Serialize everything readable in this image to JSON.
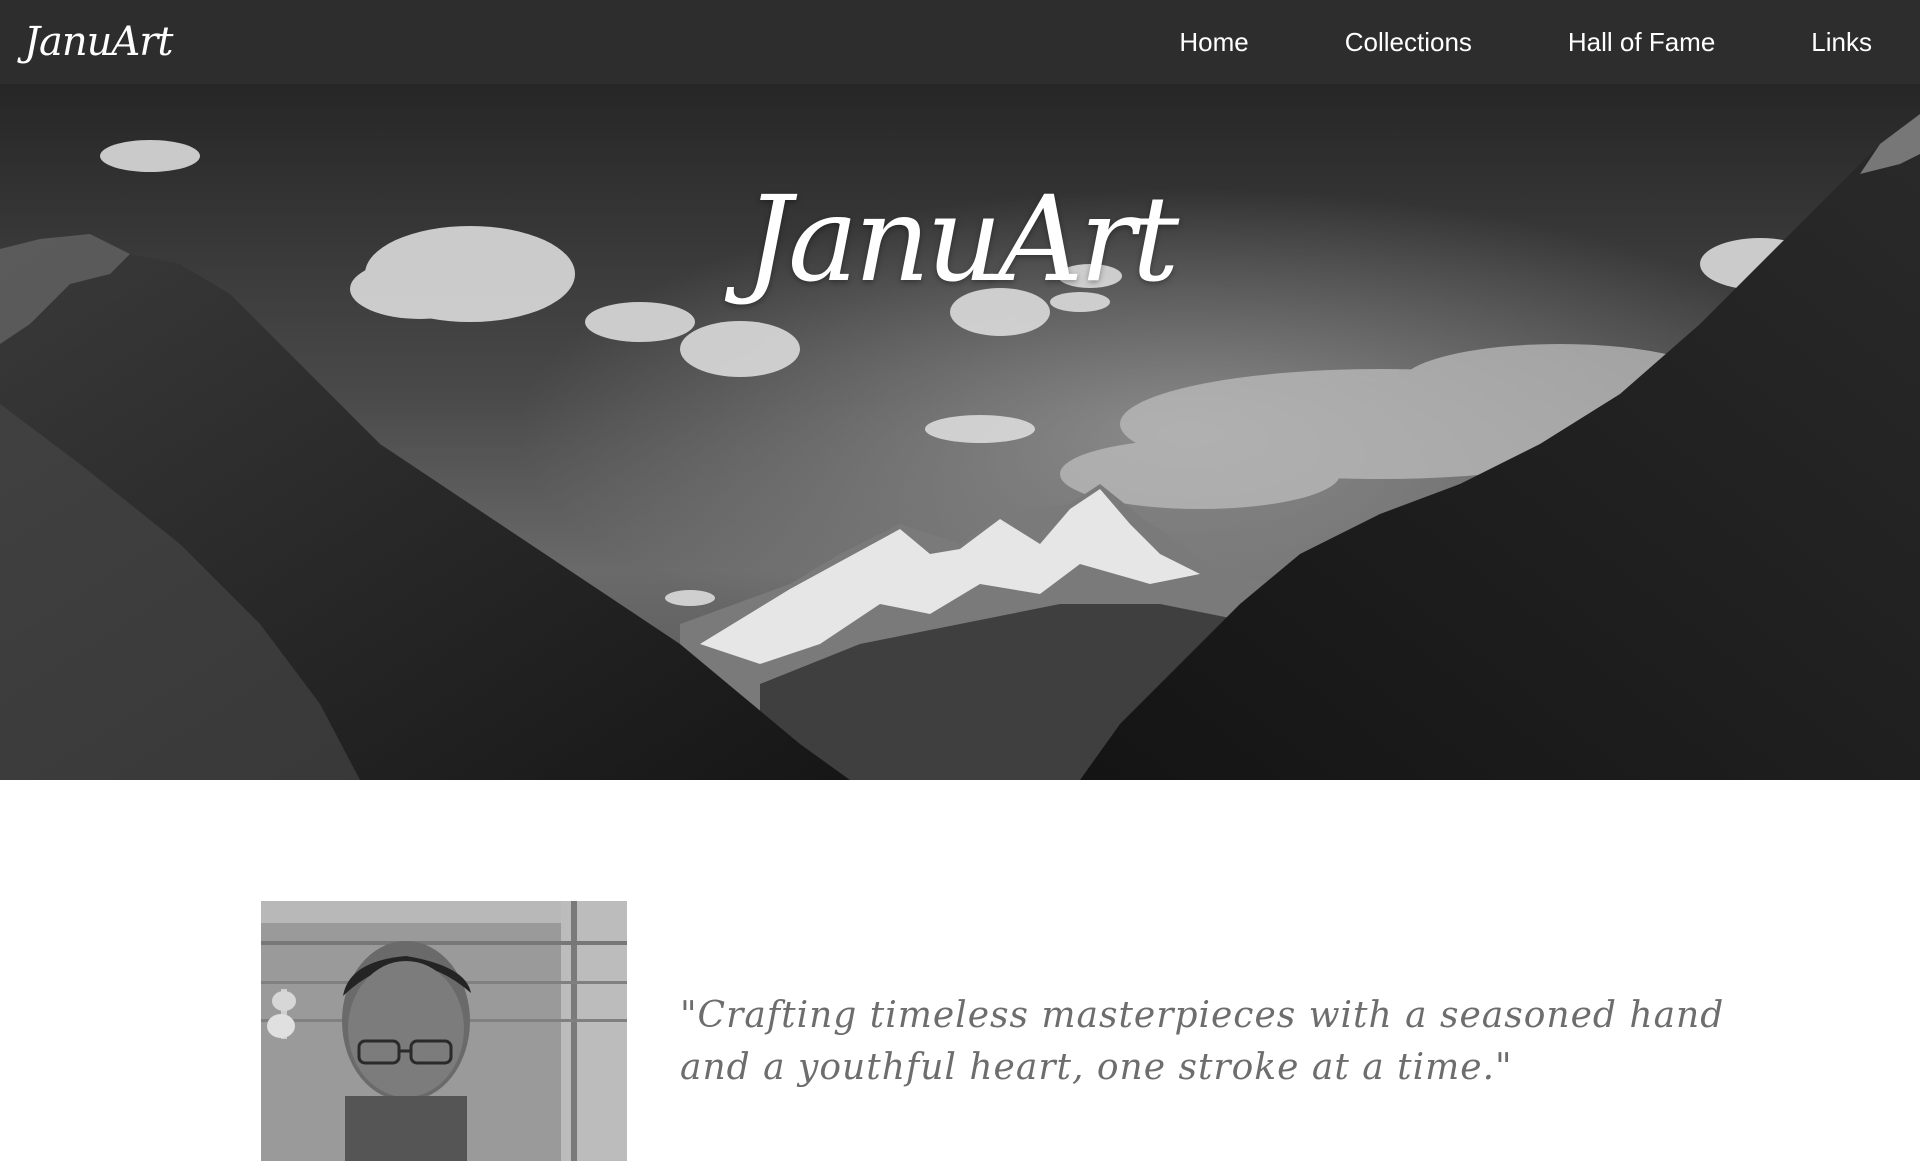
{
  "navbar": {
    "brand": "JanuArt",
    "links": [
      {
        "label": "Home"
      },
      {
        "label": "Collections"
      },
      {
        "label": "Hall of Fame"
      },
      {
        "label": "Links"
      }
    ],
    "background_color": "#2d2d2d"
  },
  "hero": {
    "title": "JanuArt",
    "image_description_icon": "mountain-landscape"
  },
  "about": {
    "quote": "\"Crafting timeless masterpieces with a seasoned hand and a youthful heart, one stroke at a time.\""
  }
}
